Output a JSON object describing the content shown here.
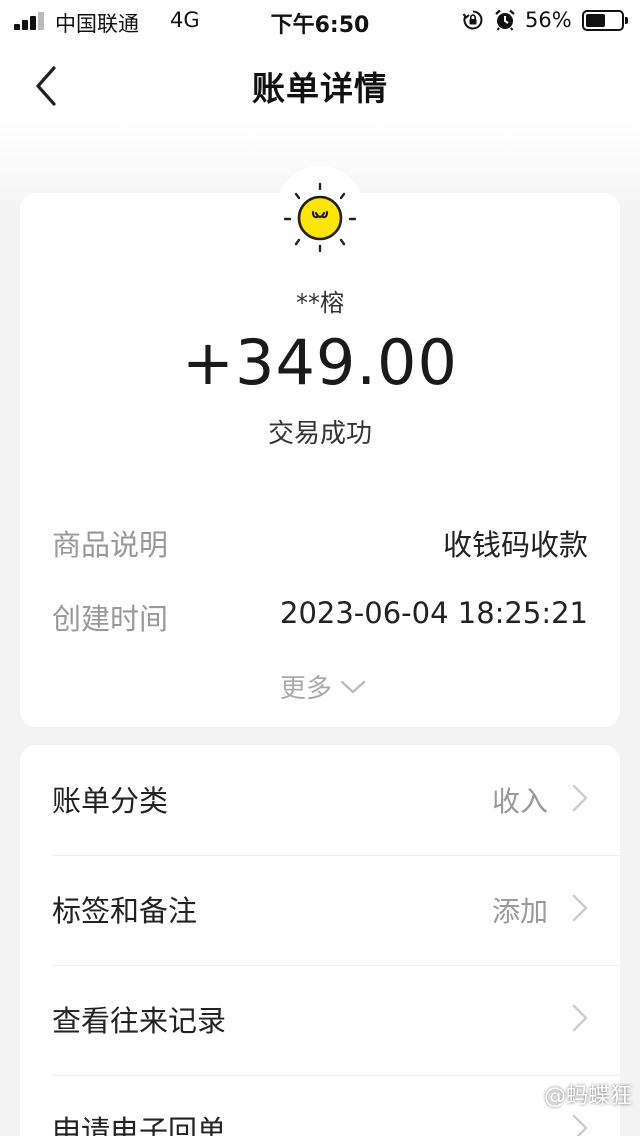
{
  "status_bar": {
    "carrier": "中国联通",
    "network": "4G",
    "time": "下午6:50",
    "battery_percent": "56%",
    "battery_level": 0.56
  },
  "nav": {
    "title": "账单详情",
    "back_icon": "chevron-left-icon"
  },
  "summary": {
    "payer": "**榕",
    "amount": "+349.00",
    "status": "交易成功",
    "avatar_icon": "sun-smiley-icon",
    "details": [
      {
        "label": "商品说明",
        "value": "收钱码收款"
      },
      {
        "label": "创建时间",
        "value": "2023-06-04 18:25:21"
      }
    ],
    "more_label": "更多"
  },
  "list": [
    {
      "label": "账单分类",
      "value": "收入"
    },
    {
      "label": "标签和备注",
      "value": "添加"
    },
    {
      "label": "查看往来记录",
      "value": ""
    },
    {
      "label": "申请电子回单",
      "value": ""
    }
  ],
  "watermark": "@蚂蝶狂",
  "colors": {
    "sun_yellow": "#FFE40A",
    "text_primary": "#222222",
    "text_secondary": "#999999",
    "background": "#F3F3F3"
  }
}
